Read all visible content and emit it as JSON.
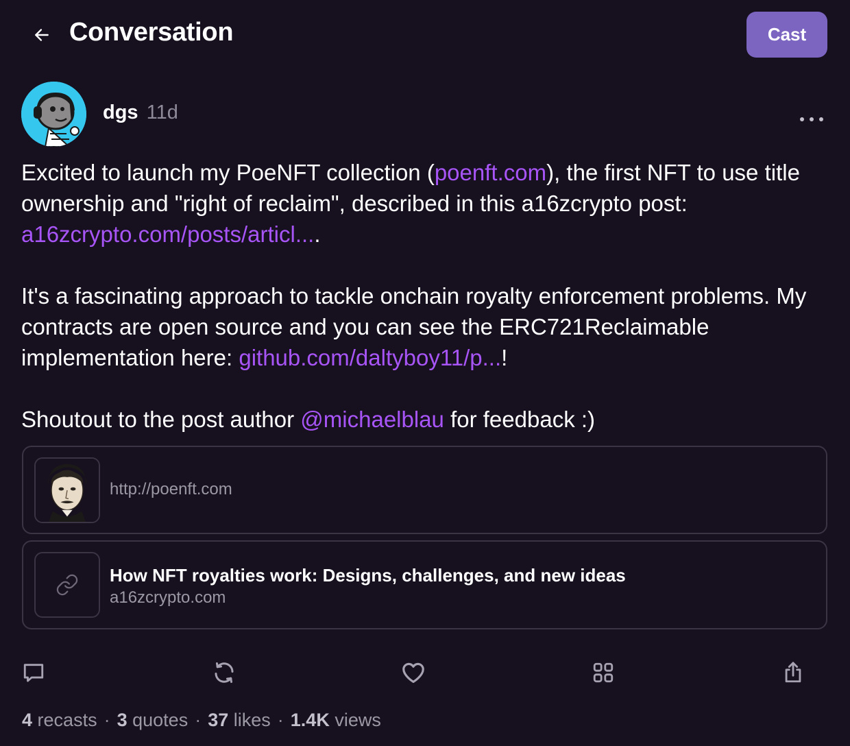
{
  "header": {
    "back_icon": "arrow-left-icon",
    "title": "Conversation",
    "cast_button": "Cast"
  },
  "post": {
    "author": "dgs",
    "timestamp": "11d",
    "body": {
      "p1_text_a": "Excited to launch my PoeNFT collection (",
      "p1_link_a": "poenft.com",
      "p1_text_b": "), the first NFT to use title ownership and \"right of reclaim\", described in this a16zcrypto post: ",
      "p1_link_b": "a16zcrypto.com/posts/articl...",
      "p1_text_c": ".",
      "p2_text_a": "It's a fascinating approach to tackle onchain royalty enforcement problems. My contracts are open source and you can see the ERC721Reclaimable implementation here: ",
      "p2_link": "github.com/daltyboy11/p...",
      "p2_text_b": "!",
      "p3_text_a": "Shoutout to the post author ",
      "p3_mention": "@michaelblau",
      "p3_text_b": " for feedback :)"
    },
    "embeds": [
      {
        "url": "http://poenft.com",
        "thumb_icon": "poe-portrait"
      },
      {
        "title": "How NFT royalties work: Designs, challenges, and new ideas",
        "domain": "a16zcrypto.com",
        "thumb_icon": "link-icon"
      }
    ],
    "stats": {
      "recasts_count": "4",
      "recasts_label": "recasts",
      "quotes_count": "3",
      "quotes_label": "quotes",
      "likes_count": "37",
      "likes_label": "likes",
      "views_count": "1.4K",
      "views_label": "views",
      "separator": "·"
    }
  },
  "colors": {
    "background": "#17101f",
    "accent": "#7c65c1",
    "link": "#a855f7",
    "muted": "#9c98a4"
  }
}
